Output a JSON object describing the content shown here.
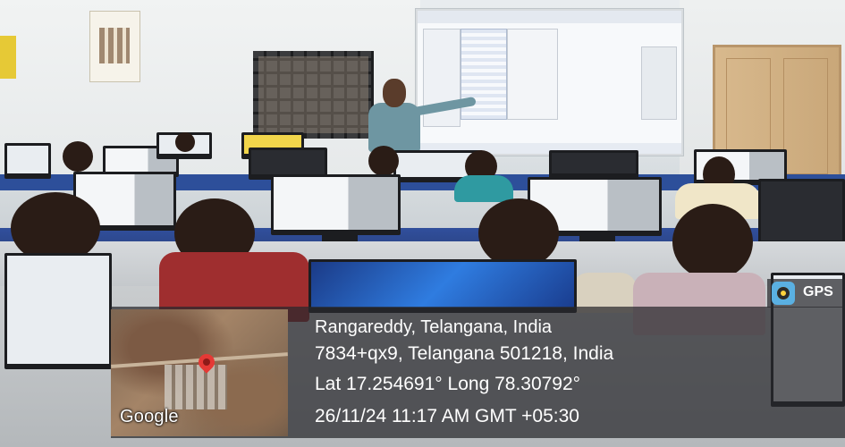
{
  "geotag": {
    "location_line": "Rangareddy, Telangana, India",
    "address_line": "7834+qx9, Telangana 501218, India",
    "coordinates_line": "Lat 17.254691° Long 78.30792°",
    "datetime_line": "26/11/24 11:17 AM GMT +05:30",
    "map_provider": "Google",
    "badge_label": "GPS"
  },
  "colors": {
    "overlay": "#2e2e32",
    "desk_blue": "#2d4f9a",
    "map_pin": "#e53935"
  },
  "icons": {
    "badge": "gps-map-camera-icon",
    "pin": "map-pin-icon"
  }
}
